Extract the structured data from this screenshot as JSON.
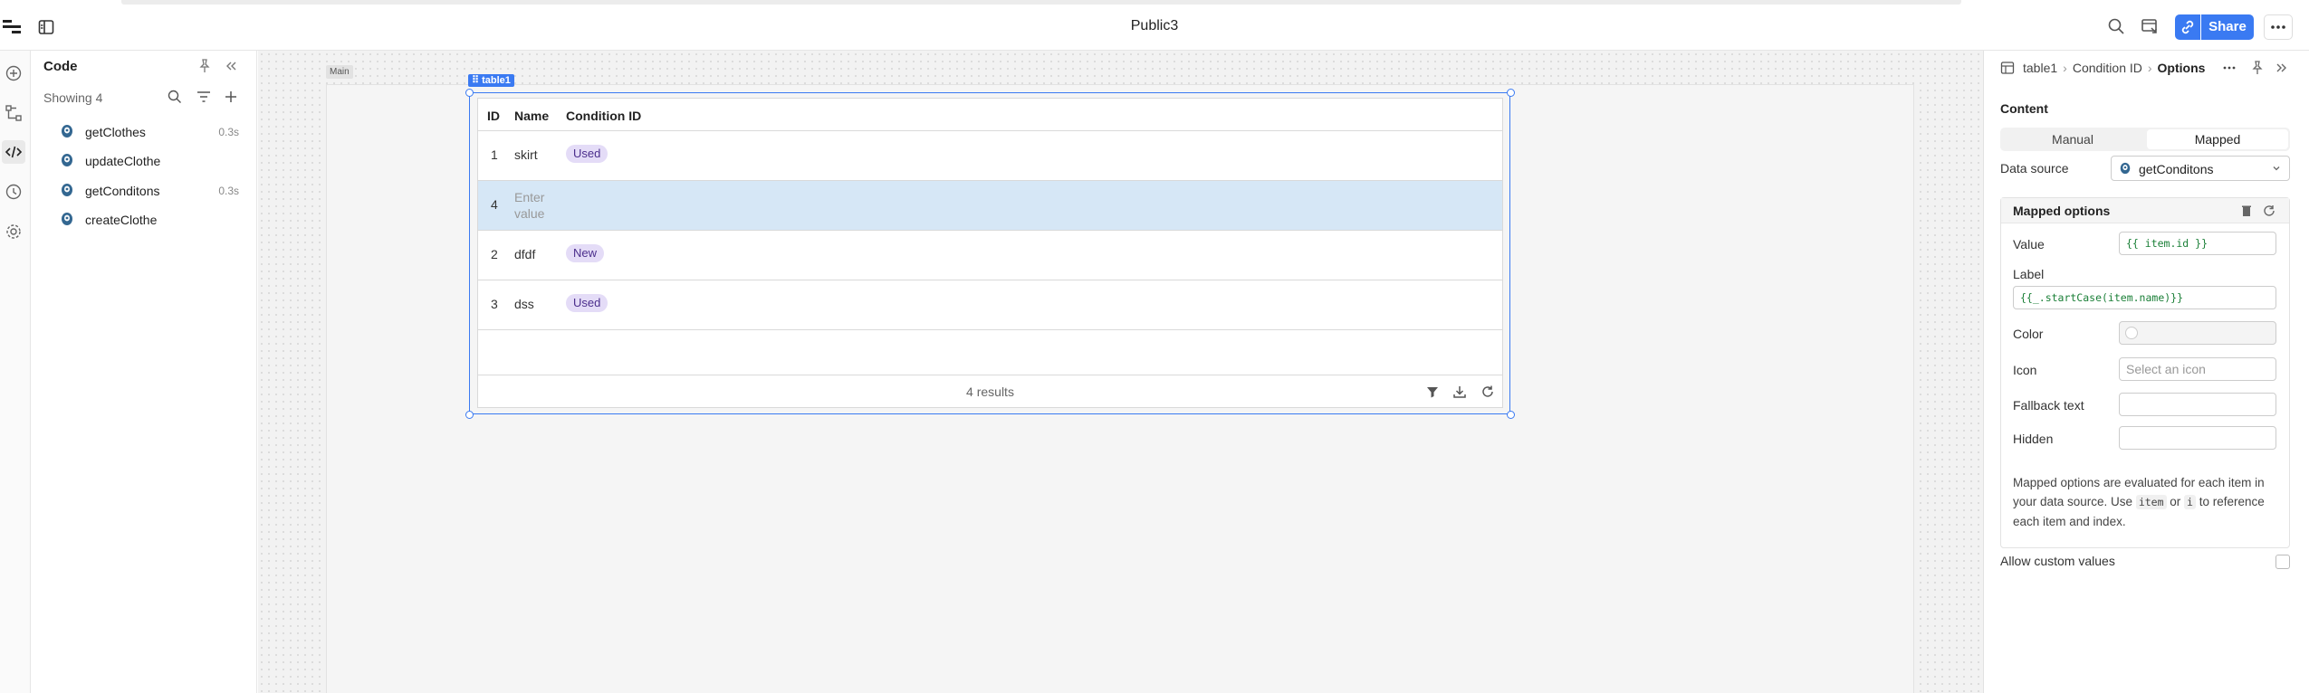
{
  "app": {
    "title": "Public3"
  },
  "topbar": {
    "share_label": "Share"
  },
  "code_panel": {
    "title": "Code",
    "showing": "Showing 4",
    "queries": [
      {
        "name": "getClothes",
        "time": "0.3s"
      },
      {
        "name": "updateClothe",
        "time": ""
      },
      {
        "name": "getConditons",
        "time": "0.3s"
      },
      {
        "name": "createClothe",
        "time": ""
      }
    ]
  },
  "canvas": {
    "frame_label": "Main",
    "component_tag": "table1",
    "table": {
      "columns": [
        "ID",
        "Name",
        "Condition ID"
      ],
      "rows": [
        {
          "id": "1",
          "name": "skirt",
          "condition": "Used"
        },
        {
          "id": "4",
          "name": "",
          "placeholder": "Enter value",
          "condition": ""
        },
        {
          "id": "2",
          "name": "dfdf",
          "condition": "New"
        },
        {
          "id": "3",
          "name": "dss",
          "condition": "Used"
        }
      ],
      "footer": "4 results"
    }
  },
  "inspector": {
    "breadcrumb": [
      "table1",
      "Condition ID",
      "Options"
    ],
    "section_title": "Content",
    "mode_options": [
      "Manual",
      "Mapped"
    ],
    "mode_selected": "Mapped",
    "data_source_label": "Data source",
    "data_source_value": "getConditons",
    "mapped_title": "Mapped options",
    "value_label": "Value",
    "value_code": "{{ item.id }}",
    "label_label": "Label",
    "label_code": "{{_.startCase(item.name)}}",
    "color_label": "Color",
    "icon_label": "Icon",
    "icon_placeholder": "Select an icon",
    "fallback_label": "Fallback text",
    "hidden_label": "Hidden",
    "note_1": "Mapped options are evaluated for each item in your data source. Use ",
    "note_code_1": "item",
    "note_2": " or ",
    "note_code_2": "i",
    "note_3": " to reference each item and index.",
    "allow_custom_label": "Allow custom values"
  },
  "colors": {
    "accent": "#3a7af2",
    "pill_bg": "#e4dcf7",
    "row_highlight": "#d6e7f6"
  }
}
